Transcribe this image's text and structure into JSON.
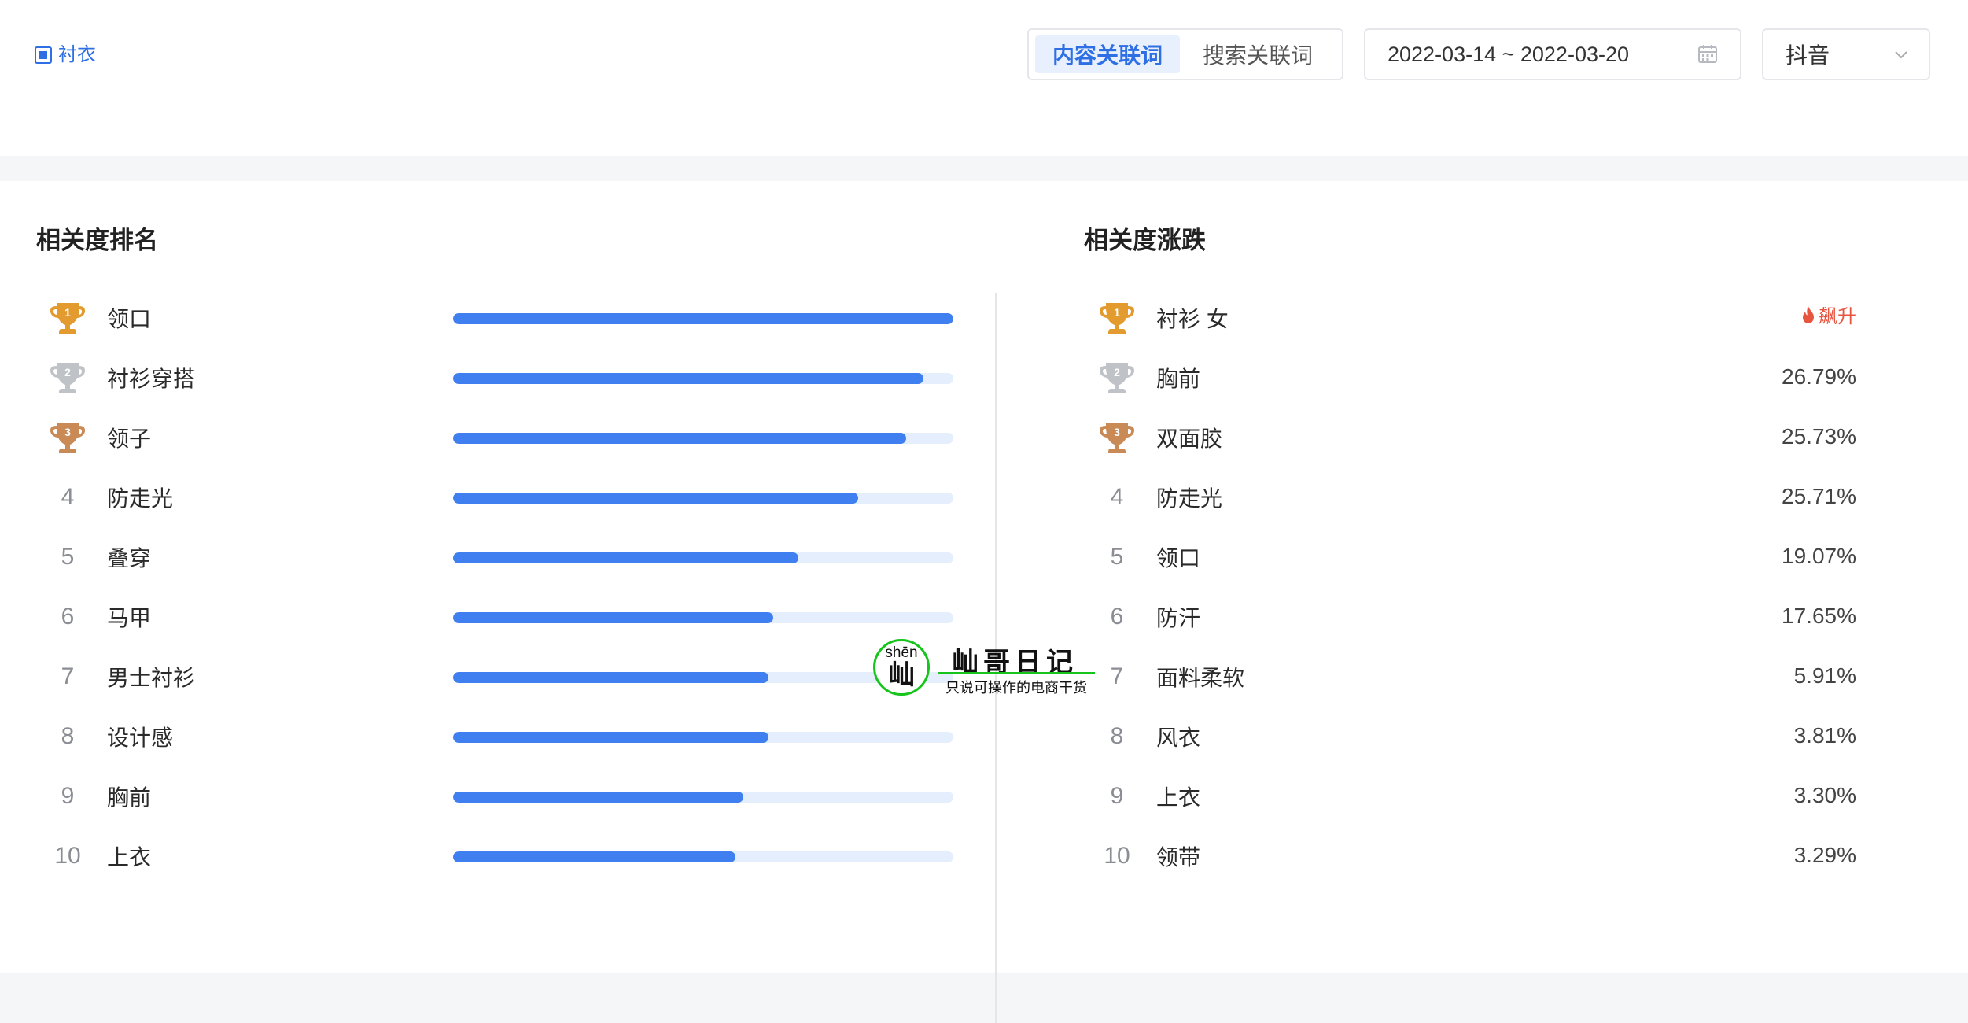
{
  "filter": {
    "keyword": "衬衣",
    "tabs": [
      {
        "label": "内容关联词",
        "active": true
      },
      {
        "label": "搜索关联词",
        "active": false
      }
    ],
    "date_range": "2022-03-14 ~ 2022-03-20",
    "platform": "抖音"
  },
  "ranking": {
    "title": "相关度排名",
    "items": [
      {
        "rank": "1",
        "label": "领口",
        "fill": 1.0
      },
      {
        "rank": "2",
        "label": "衬衫穿搭",
        "fill": 0.94
      },
      {
        "rank": "3",
        "label": "领子",
        "fill": 0.905
      },
      {
        "rank": "4",
        "label": "防走光",
        "fill": 0.81
      },
      {
        "rank": "5",
        "label": "叠穿",
        "fill": 0.69
      },
      {
        "rank": "6",
        "label": "马甲",
        "fill": 0.64
      },
      {
        "rank": "7",
        "label": "男士衬衫",
        "fill": 0.63
      },
      {
        "rank": "8",
        "label": "设计感",
        "fill": 0.63
      },
      {
        "rank": "9",
        "label": "胸前",
        "fill": 0.58
      },
      {
        "rank": "10",
        "label": "上衣",
        "fill": 0.565
      }
    ]
  },
  "change": {
    "title": "相关度涨跌",
    "items": [
      {
        "rank": "1",
        "label": "衬衫 女",
        "value": "飙升",
        "hot": true
      },
      {
        "rank": "2",
        "label": "胸前",
        "value": "26.79%"
      },
      {
        "rank": "3",
        "label": "双面胶",
        "value": "25.73%"
      },
      {
        "rank": "4",
        "label": "防走光",
        "value": "25.71%"
      },
      {
        "rank": "5",
        "label": "领口",
        "value": "19.07%"
      },
      {
        "rank": "6",
        "label": "防汗",
        "value": "17.65%"
      },
      {
        "rank": "7",
        "label": "面料柔软",
        "value": "5.91%"
      },
      {
        "rank": "8",
        "label": "风衣",
        "value": "3.81%"
      },
      {
        "rank": "9",
        "label": "上衣",
        "value": "3.30%"
      },
      {
        "rank": "10",
        "label": "领带",
        "value": "3.29%"
      }
    ]
  },
  "watermark": {
    "pinyin": "shēn",
    "char": "屾",
    "title": "屾哥日记",
    "subtitle": "只说可操作的电商干货"
  },
  "colors": {
    "accent": "#3f7ff0",
    "track": "#e4eefc",
    "gold": "#e39b2f",
    "silver": "#bfc3c8",
    "bronze": "#c98a55",
    "hot": "#e8553f"
  }
}
